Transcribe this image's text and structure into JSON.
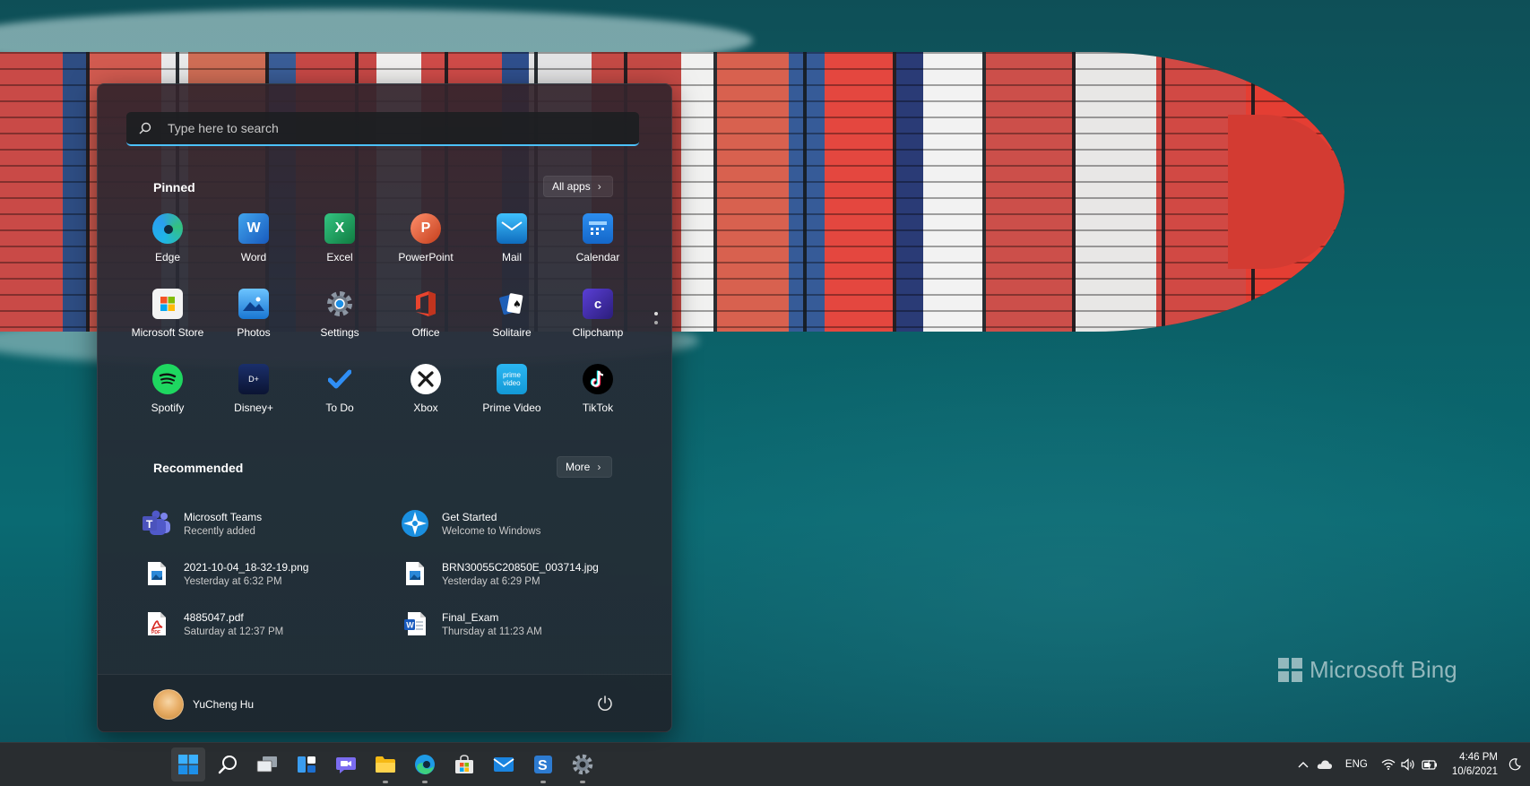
{
  "search": {
    "placeholder": "Type here to search"
  },
  "pinned": {
    "title": "Pinned",
    "all_apps_label": "All apps",
    "apps": [
      {
        "label": "Edge"
      },
      {
        "label": "Word"
      },
      {
        "label": "Excel"
      },
      {
        "label": "PowerPoint"
      },
      {
        "label": "Mail"
      },
      {
        "label": "Calendar"
      },
      {
        "label": "Microsoft Store"
      },
      {
        "label": "Photos"
      },
      {
        "label": "Settings"
      },
      {
        "label": "Office"
      },
      {
        "label": "Solitaire"
      },
      {
        "label": "Clipchamp"
      },
      {
        "label": "Spotify"
      },
      {
        "label": "Disney+"
      },
      {
        "label": "To Do"
      },
      {
        "label": "Xbox"
      },
      {
        "label": "Prime Video"
      },
      {
        "label": "TikTok"
      }
    ]
  },
  "recommended": {
    "title": "Recommended",
    "more_label": "More",
    "items": [
      {
        "name": "Microsoft Teams",
        "sub": "Recently added"
      },
      {
        "name": "Get Started",
        "sub": "Welcome to Windows"
      },
      {
        "name": "2021-10-04_18-32-19.png",
        "sub": "Yesterday at 6:32 PM"
      },
      {
        "name": "BRN30055C20850E_003714.jpg",
        "sub": "Yesterday at 6:29 PM"
      },
      {
        "name": "4885047.pdf",
        "sub": "Saturday at 12:37 PM"
      },
      {
        "name": "Final_Exam",
        "sub": "Thursday at 11:23 AM"
      }
    ]
  },
  "user": {
    "name": "YuCheng Hu"
  },
  "wallpaper": {
    "watermark": "Microsoft Bing"
  },
  "taskbar": {
    "icons": [
      "windows-start-icon",
      "search-icon",
      "task-view-icon",
      "widgets-icon",
      "chat-icon",
      "file-explorer-icon",
      "edge-icon",
      "store-icon",
      "mail-icon",
      "snagit-icon",
      "settings-icon"
    ]
  },
  "tray": {
    "language": "ENG",
    "time": "4:46 PM",
    "date": "10/6/2021"
  },
  "colors": {
    "accent": "#4cc2ff",
    "taskbar": "#202428"
  }
}
